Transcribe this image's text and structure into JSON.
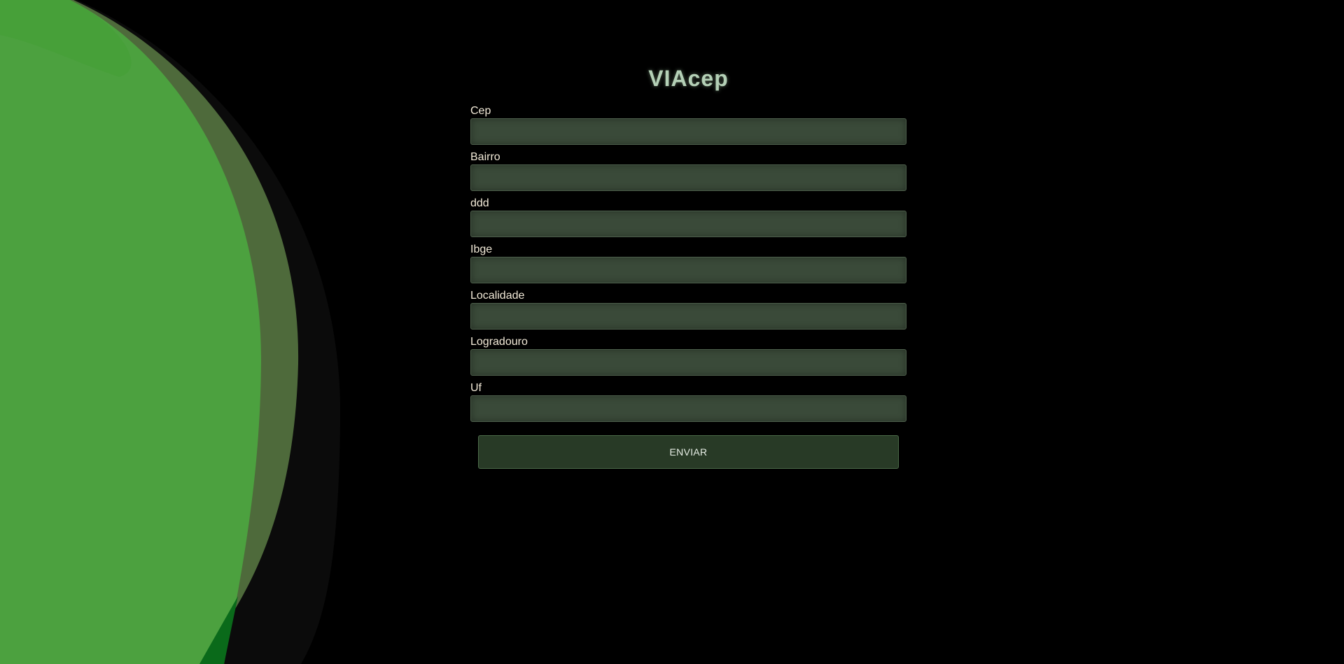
{
  "app": {
    "title": "VIAcep"
  },
  "form": {
    "fields": [
      {
        "label": "Cep",
        "value": ""
      },
      {
        "label": "Bairro",
        "value": ""
      },
      {
        "label": "ddd",
        "value": ""
      },
      {
        "label": "Ibge",
        "value": ""
      },
      {
        "label": "Localidade",
        "value": ""
      },
      {
        "label": "Logradouro",
        "value": ""
      },
      {
        "label": "Uf",
        "value": ""
      }
    ],
    "submit_label": "ENVIAR"
  },
  "colors": {
    "background": "#000000",
    "blob_primary": "#4ca13f",
    "blob_secondary": "#4f6b3c",
    "blob_dark": "#0a0a0a",
    "accent_dark_green": "#0a6a1a",
    "input_bg": "#3a4a39",
    "button_bg": "#283a26",
    "title": "#b4d0b6",
    "label": "#f2ead8"
  }
}
